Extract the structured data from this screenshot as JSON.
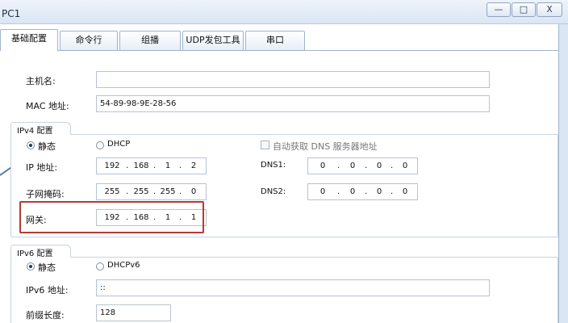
{
  "window": {
    "title": "PC1",
    "minimize": "—",
    "maximize": "□",
    "close": "X"
  },
  "tabs": [
    {
      "label": "基础配置"
    },
    {
      "label": "命令行"
    },
    {
      "label": "组播"
    },
    {
      "label": "UDP发包工具"
    },
    {
      "label": "串口"
    }
  ],
  "basic": {
    "hostname_label": "主机名:",
    "hostname_value": "",
    "mac_label": "MAC 地址:",
    "mac_value": "54-89-98-9E-28-56"
  },
  "ipv4": {
    "group_title": "IPv4 配置",
    "static_label": "静态",
    "dhcp_label": "DHCP",
    "auto_dns_label": "自动获取 DNS 服务器地址",
    "ip_label": "IP 地址:",
    "ip": [
      "192",
      "168",
      "1",
      "2"
    ],
    "mask_label": "子网掩码:",
    "mask": [
      "255",
      "255",
      "255",
      "0"
    ],
    "gateway_label": "网关:",
    "gateway": [
      "192",
      "168",
      "1",
      "1"
    ],
    "dns1_label": "DNS1:",
    "dns1": [
      "0",
      "0",
      "0",
      "0"
    ],
    "dns2_label": "DNS2:",
    "dns2": [
      "0",
      "0",
      "0",
      "0"
    ]
  },
  "ipv6": {
    "group_title": "IPv6 配置",
    "static_label": "静态",
    "dhcpv6_label": "DHCPv6",
    "address_label": "IPv6 地址:",
    "address_value": "::",
    "prefix_label": "前缀长度:",
    "prefix_value": "128"
  },
  "colors": {
    "highlight_border": "#b53a35",
    "titlebar": "#dbe6f4"
  }
}
